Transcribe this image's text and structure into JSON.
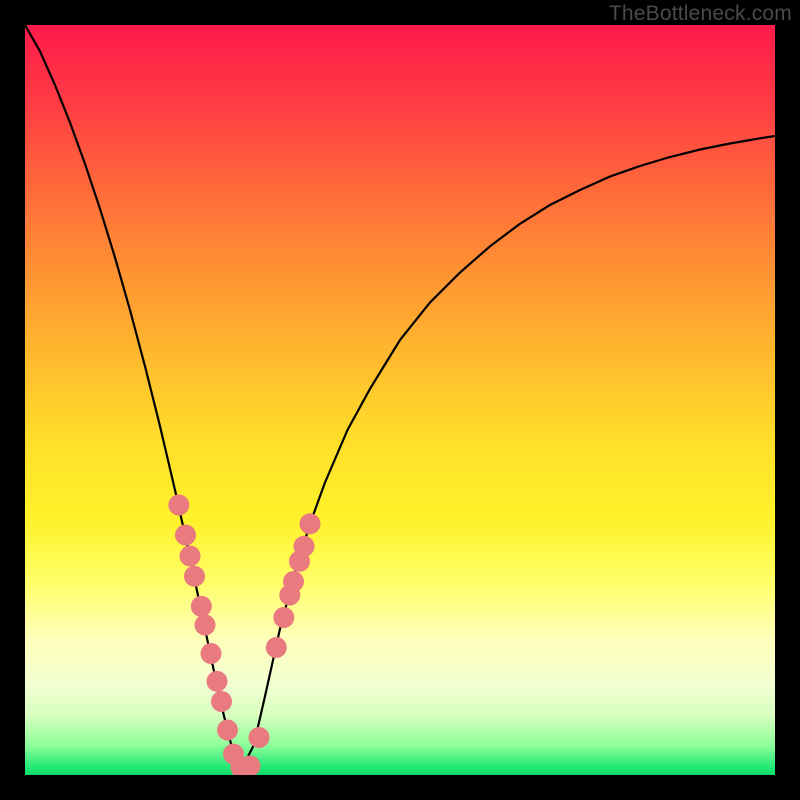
{
  "watermark": "TheBottleneck.com",
  "colors": {
    "frame": "#000000",
    "gradient_top": "#ff1a4a",
    "gradient_bottom": "#10d868",
    "curve": "#000000",
    "marker": "#e97a7f"
  },
  "chart_data": {
    "type": "line",
    "title": "",
    "xlabel": "",
    "ylabel": "",
    "xlim": [
      0,
      1
    ],
    "ylim": [
      0,
      1
    ],
    "note": "No axis ticks or numeric labels are visible; x and y are normalized (0–1). Background gradient encodes a metric from 0 (bottom, green) to 1 (top, red). The black curve is a V-shaped profile with its minimum near x≈0.29; pink markers sit along the lower flanks of the V.",
    "series": [
      {
        "name": "curve",
        "x": [
          0.0,
          0.02,
          0.04,
          0.06,
          0.08,
          0.1,
          0.12,
          0.14,
          0.16,
          0.18,
          0.2,
          0.22,
          0.24,
          0.26,
          0.275,
          0.29,
          0.305,
          0.32,
          0.34,
          0.36,
          0.38,
          0.4,
          0.43,
          0.46,
          0.5,
          0.54,
          0.58,
          0.62,
          0.66,
          0.7,
          0.74,
          0.78,
          0.82,
          0.86,
          0.9,
          0.94,
          0.98,
          1.0
        ],
        "y": [
          1.0,
          0.965,
          0.92,
          0.87,
          0.815,
          0.755,
          0.69,
          0.62,
          0.545,
          0.465,
          0.38,
          0.29,
          0.195,
          0.1,
          0.04,
          0.01,
          0.04,
          0.105,
          0.195,
          0.27,
          0.335,
          0.39,
          0.46,
          0.515,
          0.58,
          0.63,
          0.67,
          0.705,
          0.735,
          0.76,
          0.78,
          0.798,
          0.812,
          0.824,
          0.834,
          0.842,
          0.849,
          0.852
        ]
      }
    ],
    "markers": {
      "name": "highlighted-points",
      "x": [
        0.205,
        0.214,
        0.22,
        0.226,
        0.235,
        0.24,
        0.248,
        0.256,
        0.262,
        0.27,
        0.278,
        0.288,
        0.3,
        0.312,
        0.335,
        0.345,
        0.353,
        0.358,
        0.366,
        0.372,
        0.38
      ],
      "y": [
        0.36,
        0.32,
        0.292,
        0.265,
        0.225,
        0.2,
        0.162,
        0.125,
        0.098,
        0.06,
        0.028,
        0.01,
        0.012,
        0.05,
        0.17,
        0.21,
        0.24,
        0.258,
        0.285,
        0.305,
        0.335
      ],
      "r": 0.014
    }
  }
}
